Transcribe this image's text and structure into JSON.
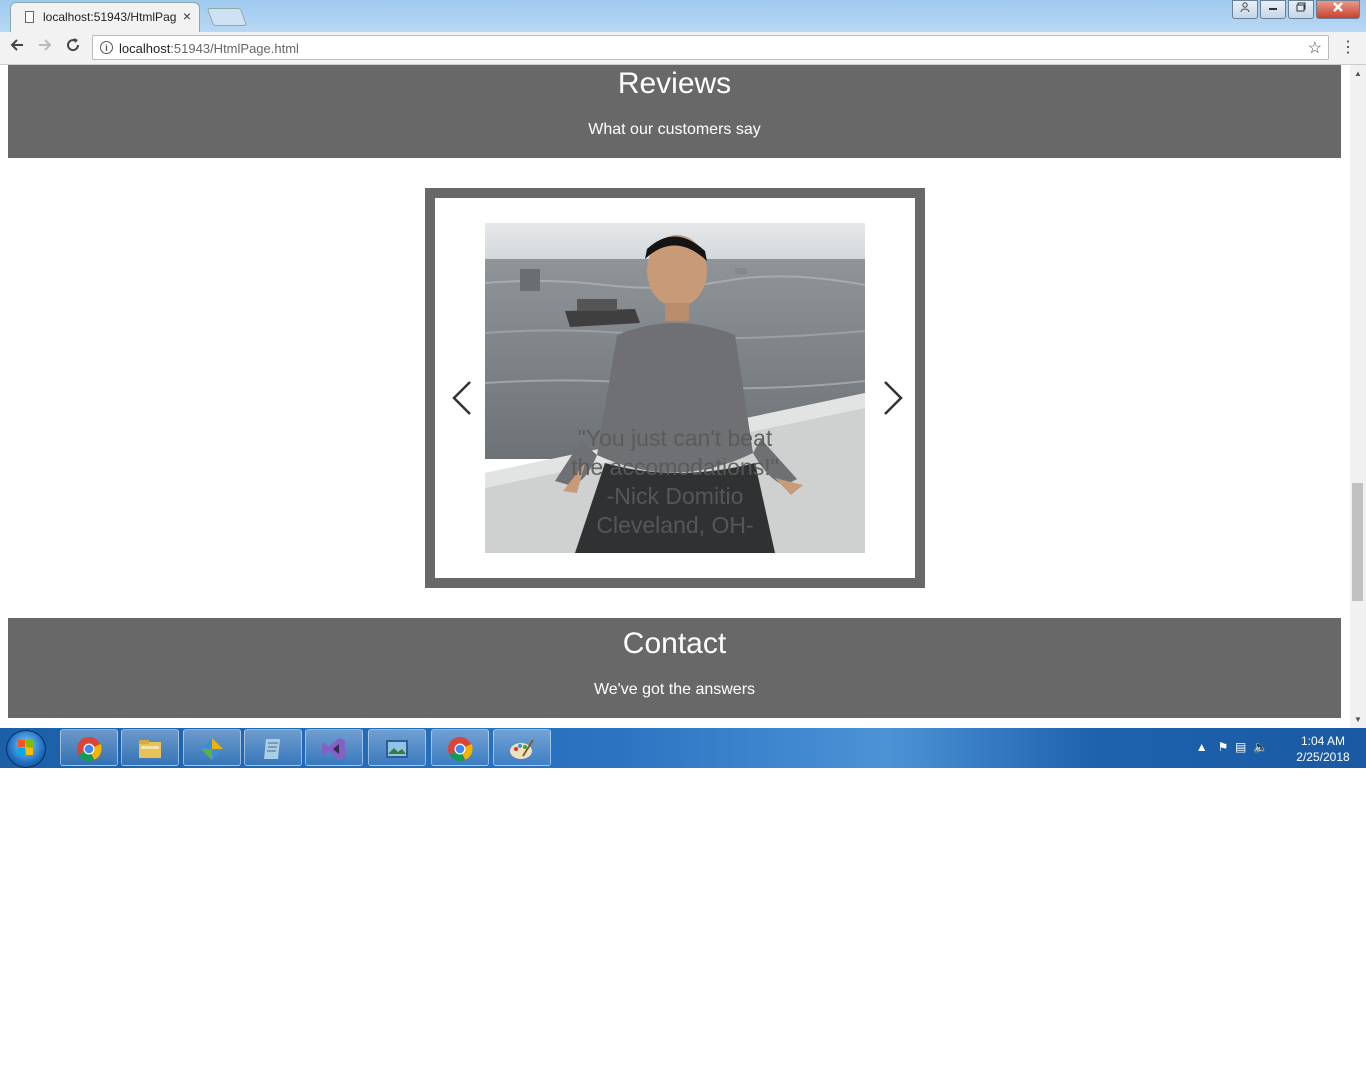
{
  "browser": {
    "tab_title": "localhost:51943/HtmlPag",
    "tab_close": "×",
    "url_host": "localhost",
    "url_path": ":51943/HtmlPage.html",
    "window_controls": [
      "▭",
      "▭",
      "❐",
      "✕"
    ]
  },
  "reviews": {
    "title": "Reviews",
    "subtitle": "What our customers say"
  },
  "carousel": {
    "quote_line1": "\"You just can't beat",
    "quote_line2": "the accomodations!\"",
    "author": "-Nick Domitio",
    "location": "Cleveland, OH-"
  },
  "contact": {
    "title": "Contact",
    "subtitle": "We've got the answers"
  },
  "taskbar": {
    "time": "1:04 AM",
    "date": "2/25/2018",
    "apps": [
      "chrome-icon",
      "file-explorer-icon",
      "app-icon",
      "notepad-icon",
      "visual-studio-icon",
      "photo-viewer-icon",
      "chrome-icon",
      "paint-icon"
    ]
  },
  "colors": {
    "section_bg": "#686868",
    "section_text": "#ffffff",
    "taskbar": "#1b5fa8"
  }
}
